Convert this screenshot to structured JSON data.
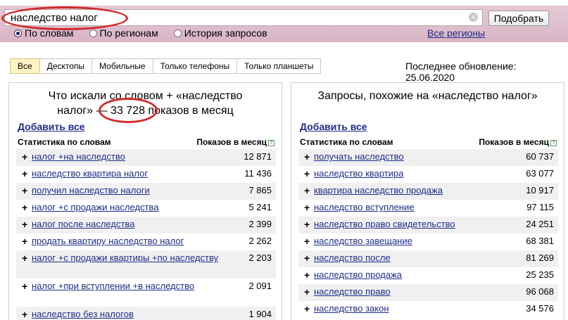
{
  "search": {
    "query": "наследство налог",
    "clear_glyph": "×",
    "submit_label": "Подобрать",
    "modes": [
      {
        "label": "По словам",
        "selected": true
      },
      {
        "label": "По регионам",
        "selected": false
      },
      {
        "label": "История запросов",
        "selected": false
      }
    ],
    "all_regions_label": "Все регионы"
  },
  "tabs": [
    "Все",
    "Десктопы",
    "Мобильные",
    "Только телефоны",
    "Только планшеты"
  ],
  "active_tab": "Все",
  "last_update": "Последнее обновление: 25.06.2020",
  "left": {
    "title_line1": "Что искали со словом  +  «наследство",
    "title_line2": "налог» — 33 728 показов в месяц",
    "add_all": "Добавить все",
    "col_phrase": "Статистика по словам",
    "col_count": "Показов в месяц",
    "help_glyph": "?",
    "rows": [
      {
        "plus": "+",
        "phrase": "налог +на наследство",
        "count": "12 871"
      },
      {
        "plus": "+",
        "phrase": "наследство квартира налог",
        "count": "11 436"
      },
      {
        "plus": "+",
        "phrase": "получил наследство налоги",
        "count": "7 865"
      },
      {
        "plus": "+",
        "phrase": "налог +с продажи наследства",
        "count": "5 241"
      },
      {
        "plus": "+",
        "phrase": "налог после наследства",
        "count": "2 399"
      },
      {
        "plus": "+",
        "phrase": "продать квартиру наследство налог",
        "count": "2 262"
      },
      {
        "plus": "+",
        "phrase": "налог +с продажи квартиры +по наследству",
        "count": "2 203"
      },
      {
        "plus": "+",
        "phrase": "налог +при вступлении +в наследство",
        "count": "2 091"
      },
      {
        "plus": "+",
        "phrase": "наследство без налогов",
        "count": "1 904"
      }
    ]
  },
  "right": {
    "title": "Запросы, похожие на «наследство налог»",
    "add_all": "Добавить все",
    "col_phrase": "Статистика по словам",
    "col_count": "Показов в месяц",
    "help_glyph": "?",
    "rows": [
      {
        "plus": "+",
        "phrase": "получать наследство",
        "count": "60 737"
      },
      {
        "plus": "+",
        "phrase": "наследство квартира",
        "count": "63 077"
      },
      {
        "plus": "+",
        "phrase": "квартира наследство продажа",
        "count": "10 917"
      },
      {
        "plus": "+",
        "phrase": "наследство вступление",
        "count": "97 115"
      },
      {
        "plus": "+",
        "phrase": "наследство право свидетельство",
        "count": "24 251"
      },
      {
        "plus": "+",
        "phrase": "наследство завещание",
        "count": "68 381"
      },
      {
        "plus": "+",
        "phrase": "наследство после",
        "count": "81 269"
      },
      {
        "plus": "+",
        "phrase": "наследство продажа",
        "count": "25 235"
      },
      {
        "plus": "+",
        "phrase": "наследство право",
        "count": "96 068"
      },
      {
        "plus": "+",
        "phrase": "наследство закон",
        "count": "34 576"
      }
    ]
  }
}
